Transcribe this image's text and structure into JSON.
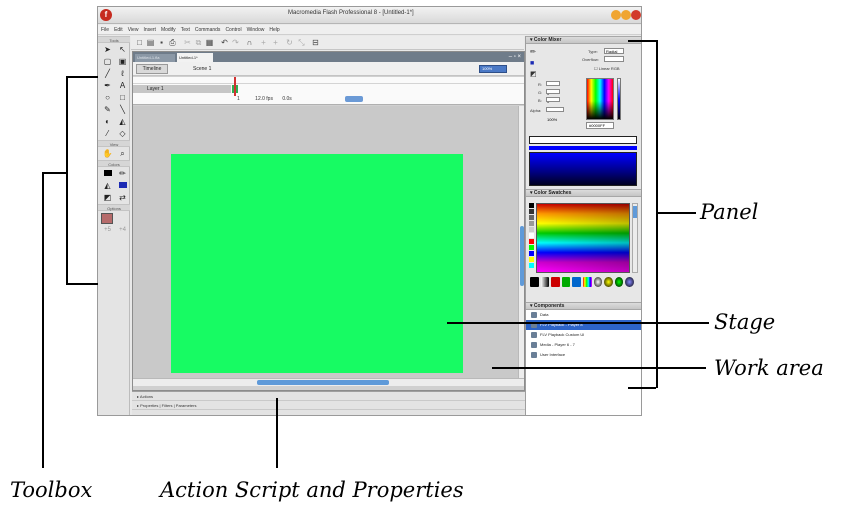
{
  "app": {
    "title": "Macromedia Flash Professional 8 - [Untitled-1*]",
    "menu": [
      "File",
      "Edit",
      "View",
      "Insert",
      "Modify",
      "Text",
      "Commands",
      "Control",
      "Window",
      "Help"
    ]
  },
  "toolbox": {
    "tools_header": "Tools",
    "view_header": "View",
    "colors_header": "Colors",
    "options_header": "Options",
    "tools": [
      "selection-icon",
      "subselection-icon",
      "free-transform-icon",
      "fill-transform-icon",
      "line-icon",
      "lasso-icon",
      "pen-icon",
      "text-icon",
      "oval-icon",
      "rectangle-icon",
      "pencil-icon",
      "brush-icon",
      "ink-bottle-icon",
      "paint-bucket-icon",
      "eyedropper-icon",
      "eraser-icon"
    ]
  },
  "document": {
    "tab_inactive": "Untitled-1.fla",
    "tab_active": "Untitled-1*",
    "timeline_button": "Timeline",
    "scene_label": "Scene 1",
    "zoom": "100%",
    "layer_name": "Layer 1",
    "status": {
      "frame": "1",
      "fps": "12.0 fps",
      "time": "0.0s"
    },
    "stage_color": "#17fb63"
  },
  "bottom_panels": {
    "actions": "Actions",
    "properties": "Properties",
    "filters": "Filters",
    "parameters": "Parameters"
  },
  "panels": {
    "color_mixer": {
      "title": "Color Mixer",
      "type_label": "Type:",
      "type_value": "Radial",
      "overflow_label": "Overflow:",
      "linear_rgb": "Linear RGB",
      "r": "0",
      "g": "0",
      "b": "255",
      "alpha_label": "Alpha:",
      "alpha": "100%",
      "hex": "#0000FF"
    },
    "color_swatches": {
      "title": "Color Swatches"
    },
    "components": {
      "title": "Components",
      "items": [
        "Data",
        "FLV Playback - Player 8",
        "FLV Playback Custom UI",
        "Media - Player 6 - 7",
        "User Interface"
      ],
      "selected_index": 1
    }
  },
  "annotations": {
    "panel": "Panel",
    "stage": "Stage",
    "work_area": "Work area",
    "toolbox": "Toolbox",
    "action_script": "Action Script  and  Properties"
  }
}
